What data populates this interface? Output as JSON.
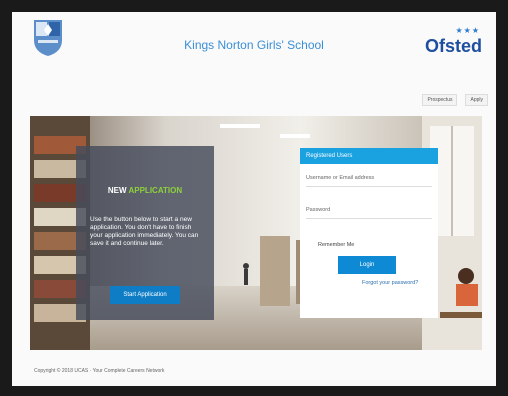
{
  "header": {
    "school_name": "Kings Norton Girls' School",
    "ofsted_logo": "Ofsted",
    "crest_icon": "school-crest-icon"
  },
  "toplinks": [
    {
      "label": "Prospectus"
    },
    {
      "label": "Apply"
    }
  ],
  "new_application": {
    "title_part1": "NEW",
    "title_part2": "APPLICATION",
    "description": "Use the button below to start a new application. You don't have to finish your application immediately. You can save it and continue later.",
    "button_label": "Start Application"
  },
  "login": {
    "heading": "Registered Users",
    "username_placeholder": "Username or Email address",
    "password_placeholder": "Password",
    "remember_label": "Remember Me",
    "login_button": "Login",
    "forgot_link": "Forgot your password?"
  },
  "footer": {
    "copyright": "Copyright © 2018 UCAS · Your Complete Careers Network"
  },
  "colors": {
    "accent": "#1aa1e0",
    "button": "#0e7dc6",
    "highlight": "#8ed13c",
    "ofsted": "#1f4fa0"
  }
}
